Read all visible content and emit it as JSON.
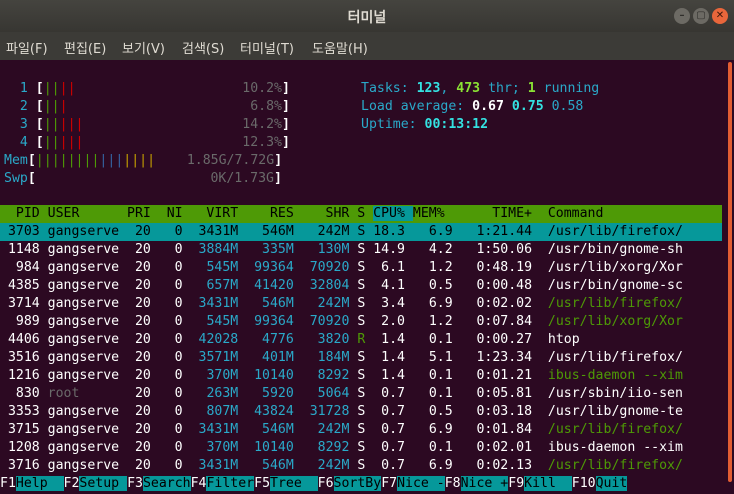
{
  "window": {
    "title": "터미널",
    "minimize": "–",
    "maximize": "▢",
    "close": "✕"
  },
  "menu": [
    "파일(F)",
    "편집(E)",
    "보기(V)",
    "검색(S)",
    "터미널(T)",
    "도움말(H)"
  ],
  "cpus": [
    {
      "label": "1",
      "bars": "||||",
      "value": "10.2%"
    },
    {
      "label": "2",
      "bars": "|||",
      "value": "6.8%"
    },
    {
      "label": "3",
      "bars": "|||||",
      "value": "14.2%"
    },
    {
      "label": "4",
      "bars": "|||||",
      "value": "12.3%"
    }
  ],
  "mem": {
    "label": "Mem",
    "bars": "|||||||||||||||",
    "value": "1.85G/7.72G"
  },
  "swp": {
    "label": "Swp",
    "value": "0K/1.73G"
  },
  "tasks": {
    "label": "Tasks: ",
    "count": "123",
    "sep": ", ",
    "threads": "473",
    "thr_label": " thr; ",
    "running": "1",
    "running_label": " running"
  },
  "load": {
    "label": "Load average: ",
    "v1": "0.67",
    "v2": "0.75",
    "v3": "0.58"
  },
  "uptime": {
    "label": "Uptime: ",
    "value": "00:13:12"
  },
  "columns": {
    "pid": "PID",
    "user": "USER",
    "pri": "PRI",
    "ni": "NI",
    "virt": "VIRT",
    "res": "RES",
    "shr": "SHR",
    "s": "S",
    "cpu": "CPU%",
    "mem": "MEM%",
    "time": "TIME+",
    "command": "Command"
  },
  "processes": [
    {
      "pid": "3703",
      "user": "gangserve",
      "pri": "20",
      "ni": "0",
      "virt": "3431M",
      "res": "546M",
      "shr": "242M",
      "s": "S",
      "cpu": "18.3",
      "mem": "6.9",
      "time": "1:21.44",
      "command": "/usr/lib/firefox/"
    },
    {
      "pid": "1148",
      "user": "gangserve",
      "pri": "20",
      "ni": "0",
      "virt": "3884M",
      "res": "335M",
      "shr": "130M",
      "s": "S",
      "cpu": "14.9",
      "mem": "4.2",
      "time": "1:50.06",
      "command": "/usr/bin/gnome-sh"
    },
    {
      "pid": "984",
      "user": "gangserve",
      "pri": "20",
      "ni": "0",
      "virt": "545M",
      "res": "99364",
      "shr": "70920",
      "s": "S",
      "cpu": "6.1",
      "mem": "1.2",
      "time": "0:48.19",
      "command": "/usr/lib/xorg/Xor"
    },
    {
      "pid": "4385",
      "user": "gangserve",
      "pri": "20",
      "ni": "0",
      "virt": "657M",
      "res": "41420",
      "shr": "32804",
      "s": "S",
      "cpu": "4.1",
      "mem": "0.5",
      "time": "0:00.48",
      "command": "/usr/bin/gnome-sc"
    },
    {
      "pid": "3714",
      "user": "gangserve",
      "pri": "20",
      "ni": "0",
      "virt": "3431M",
      "res": "546M",
      "shr": "242M",
      "s": "S",
      "cpu": "3.4",
      "mem": "6.9",
      "time": "0:02.02",
      "command": "/usr/lib/firefox/"
    },
    {
      "pid": "989",
      "user": "gangserve",
      "pri": "20",
      "ni": "0",
      "virt": "545M",
      "res": "99364",
      "shr": "70920",
      "s": "S",
      "cpu": "2.0",
      "mem": "1.2",
      "time": "0:07.84",
      "command": "/usr/lib/xorg/Xor"
    },
    {
      "pid": "4406",
      "user": "gangserve",
      "pri": "20",
      "ni": "0",
      "virt": "42028",
      "res": "4776",
      "shr": "3820",
      "s": "R",
      "cpu": "1.4",
      "mem": "0.1",
      "time": "0:00.27",
      "command": "htop"
    },
    {
      "pid": "3516",
      "user": "gangserve",
      "pri": "20",
      "ni": "0",
      "virt": "3571M",
      "res": "401M",
      "shr": "184M",
      "s": "S",
      "cpu": "1.4",
      "mem": "5.1",
      "time": "1:23.34",
      "command": "/usr/lib/firefox/"
    },
    {
      "pid": "1216",
      "user": "gangserve",
      "pri": "20",
      "ni": "0",
      "virt": "370M",
      "res": "10140",
      "shr": "8292",
      "s": "S",
      "cpu": "1.4",
      "mem": "0.1",
      "time": "0:01.21",
      "command": "ibus-daemon --xim"
    },
    {
      "pid": "830",
      "user": "root",
      "pri": "20",
      "ni": "0",
      "virt": "263M",
      "res": "5920",
      "shr": "5064",
      "s": "S",
      "cpu": "0.7",
      "mem": "0.1",
      "time": "0:05.81",
      "command": "/usr/sbin/iio-sen"
    },
    {
      "pid": "3353",
      "user": "gangserve",
      "pri": "20",
      "ni": "0",
      "virt": "807M",
      "res": "43824",
      "shr": "31728",
      "s": "S",
      "cpu": "0.7",
      "mem": "0.5",
      "time": "0:03.18",
      "command": "/usr/lib/gnome-te"
    },
    {
      "pid": "3715",
      "user": "gangserve",
      "pri": "20",
      "ni": "0",
      "virt": "3431M",
      "res": "546M",
      "shr": "242M",
      "s": "S",
      "cpu": "0.7",
      "mem": "6.9",
      "time": "0:01.84",
      "command": "/usr/lib/firefox/"
    },
    {
      "pid": "1208",
      "user": "gangserve",
      "pri": "20",
      "ni": "0",
      "virt": "370M",
      "res": "10140",
      "shr": "8292",
      "s": "S",
      "cpu": "0.7",
      "mem": "0.1",
      "time": "0:02.01",
      "command": "ibus-daemon --xim"
    },
    {
      "pid": "3716",
      "user": "gangserve",
      "pri": "20",
      "ni": "0",
      "virt": "3431M",
      "res": "546M",
      "shr": "242M",
      "s": "S",
      "cpu": "0.7",
      "mem": "6.9",
      "time": "0:02.13",
      "command": "/usr/lib/firefox/"
    }
  ],
  "fkeys": [
    {
      "key": "F1",
      "label": "Help  "
    },
    {
      "key": "F2",
      "label": "Setup "
    },
    {
      "key": "F3",
      "label": "Search"
    },
    {
      "key": "F4",
      "label": "Filter"
    },
    {
      "key": "F5",
      "label": "Tree  "
    },
    {
      "key": "F6",
      "label": "SortBy"
    },
    {
      "key": "F7",
      "label": "Nice -"
    },
    {
      "key": "F8",
      "label": "Nice +"
    },
    {
      "key": "F9",
      "label": "Kill  "
    },
    {
      "key": "F10",
      "label": "Quit"
    }
  ]
}
